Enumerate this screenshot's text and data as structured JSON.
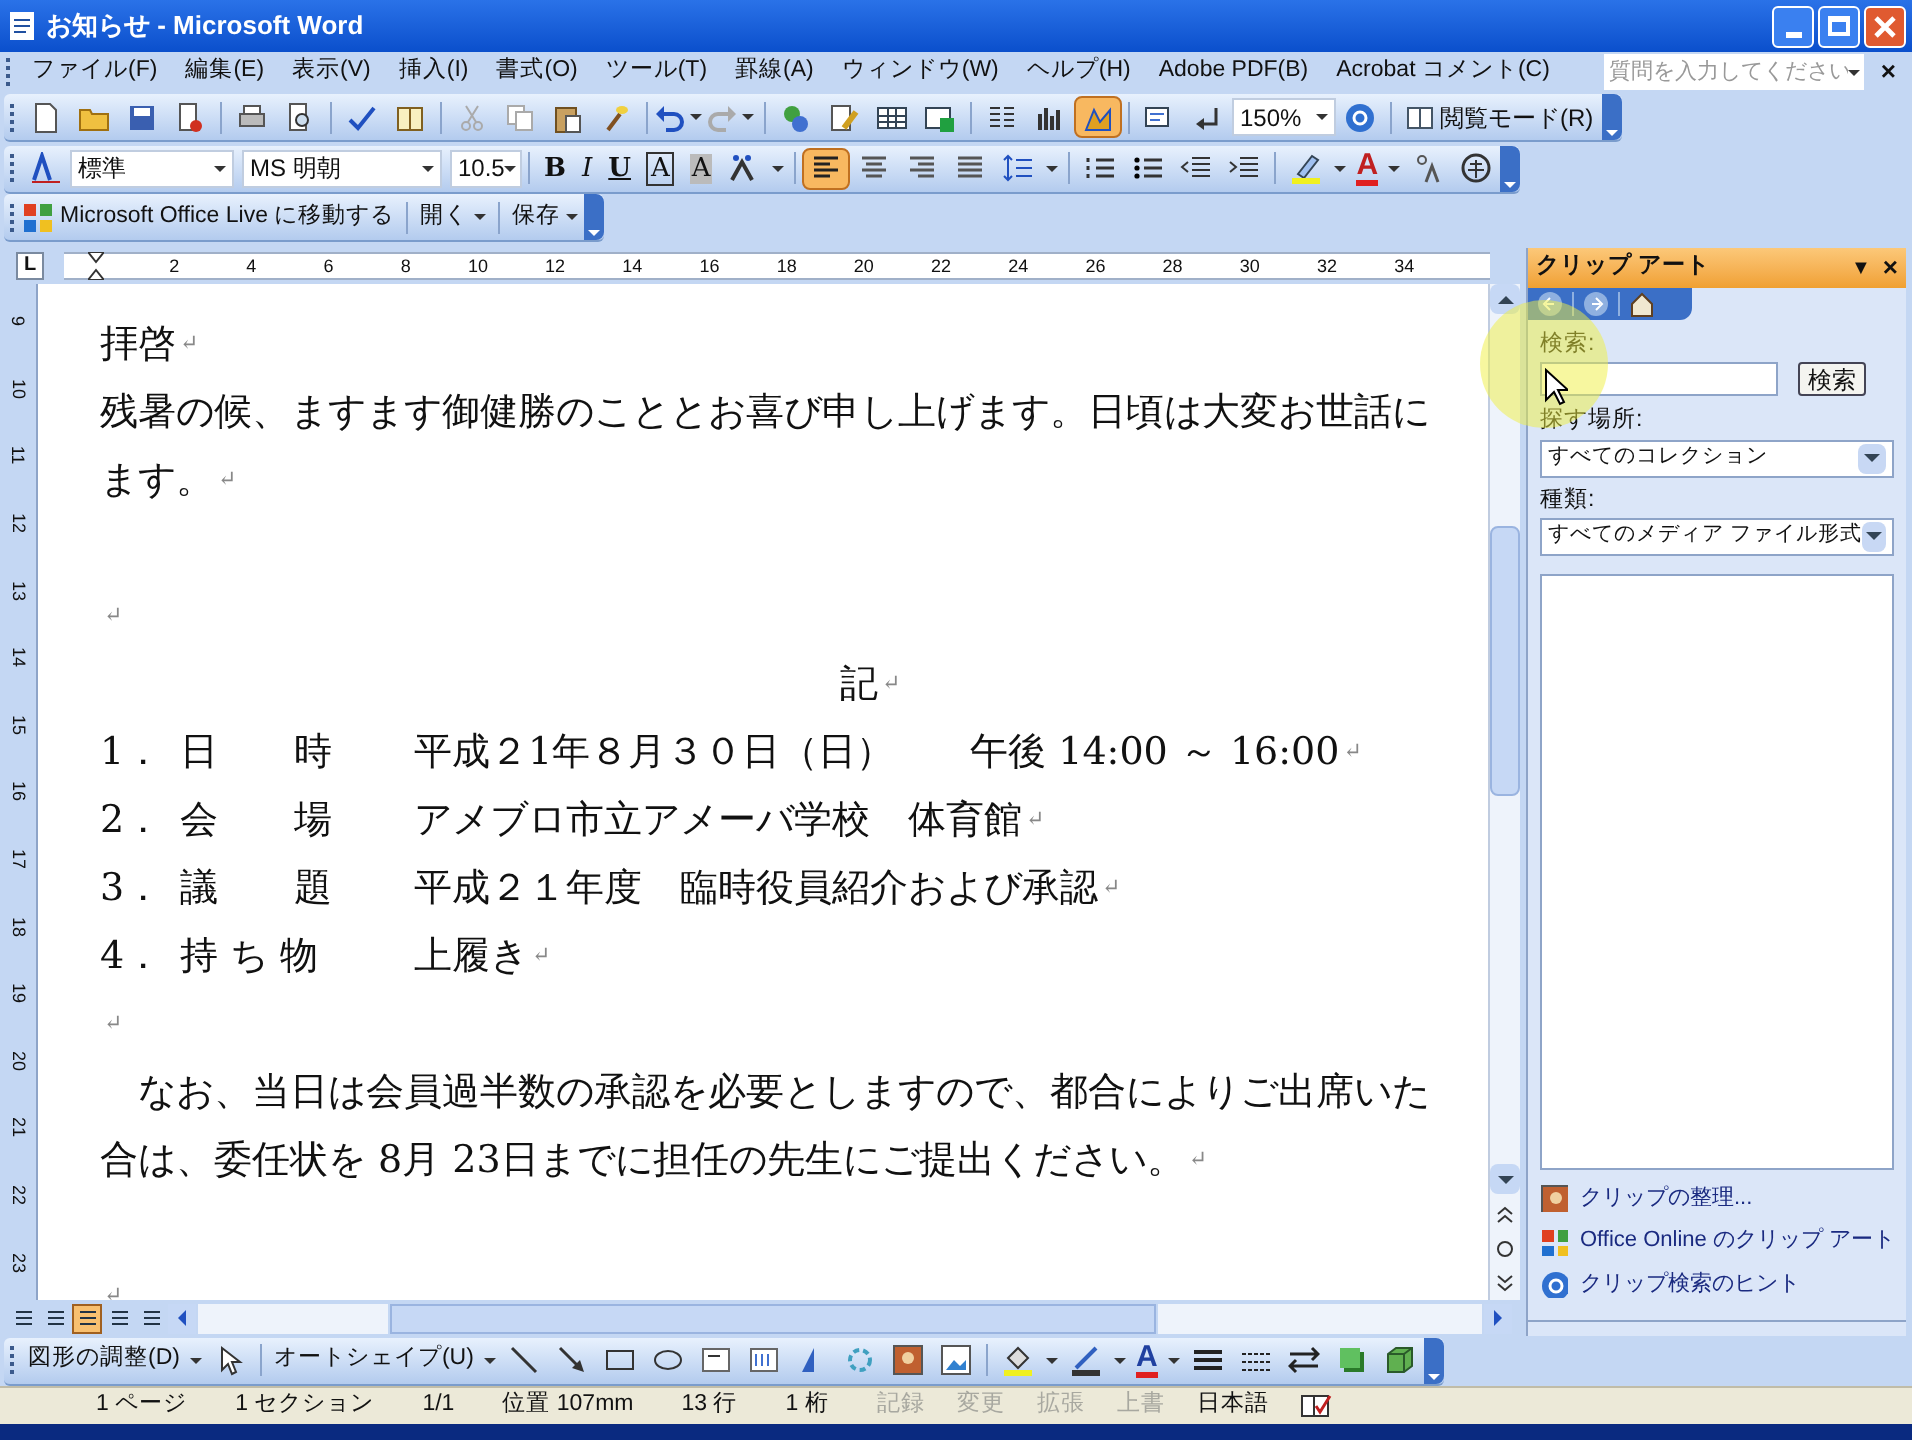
{
  "window": {
    "title": "お知らせ - Microsoft Word"
  },
  "menu": [
    "ファイル(F)",
    "編集(E)",
    "表示(V)",
    "挿入(I)",
    "書式(O)",
    "ツール(T)",
    "罫線(A)",
    "ウィンドウ(W)",
    "ヘルプ(H)",
    "Adobe PDF(B)",
    "Acrobat コメント(C)"
  ],
  "help_box": {
    "placeholder": "質問を入力してください",
    "close": "×"
  },
  "standard_toolbar": {
    "drawing": {
      "selected": true
    },
    "zoom": "150%",
    "reading_mode": "閲覧モード(R)"
  },
  "formatting_toolbar": {
    "style": "標準",
    "font": "MS 明朝",
    "size": "10.5",
    "format_buttons": [
      "B",
      "I",
      "U",
      "A",
      "A"
    ],
    "alignment": [
      {
        "selected": true
      },
      {
        "selected": false
      },
      {
        "selected": false
      },
      {
        "selected": false
      }
    ],
    "font_color": "A"
  },
  "web_toolbar": {
    "items": [
      "Microsoft Office Live に移動する",
      "開く",
      "保存"
    ]
  },
  "ruler": {
    "tab": "L",
    "labels": [
      "2",
      "4",
      "6",
      "8",
      "10",
      "12",
      "14",
      "16",
      "18",
      "20",
      "22",
      "24",
      "26",
      "28",
      "30",
      "32",
      "34"
    ]
  },
  "vertical_ruler": [
    "9",
    "10",
    "11",
    "12",
    "13",
    "14",
    "15",
    "16",
    "17",
    "18",
    "19",
    "20",
    "21",
    "22",
    "23"
  ],
  "document": {
    "lines": [
      {
        "kind": "text",
        "text": "拝啓",
        "mark": "↵"
      },
      {
        "kind": "text",
        "text": "残暑の候、ますます御健勝のこととお喜び申し上げます。日頃は大変お世話に"
      },
      {
        "kind": "text",
        "text": "ます。",
        "mark": "↵"
      },
      {
        "kind": "gap"
      },
      {
        "kind": "text",
        "mark": "↵"
      },
      {
        "kind": "center",
        "text": "記",
        "mark": "↵"
      },
      {
        "kind": "item",
        "number": "1．",
        "label": "日　　時",
        "value": "平成２1年８月３０日（日）　　午後 14:00 ～ 16:00",
        "mark": "↵"
      },
      {
        "kind": "item",
        "number": "2．",
        "label": "会　　場",
        "value": "アメブロ市立アメーバ学校　体育館",
        "mark": "↵"
      },
      {
        "kind": "item",
        "number": "3．",
        "label": "議　　題",
        "value": "平成２１年度　臨時役員紹介および承認",
        "mark": "↵"
      },
      {
        "kind": "item",
        "number": "4．",
        "label": "持 ち 物",
        "value": "上履き",
        "mark": "↵"
      },
      {
        "kind": "text",
        "mark": "↵"
      },
      {
        "kind": "text",
        "text": "　なお、当日は会員過半数の承認を必要としますので、都合によりご出席いた"
      },
      {
        "kind": "text",
        "text": "合は、委任状を 8月 23日までに担任の先生にご提出ください。",
        "mark": "↵"
      },
      {
        "kind": "gap"
      },
      {
        "kind": "text",
        "mark": "↵"
      }
    ]
  },
  "task_pane": {
    "title": "クリップ アート",
    "menu": "▼",
    "close": "×",
    "search_label": "検索:",
    "search_button": "検索",
    "location_label": "探す場所:",
    "location": "すべてのコレクション",
    "type_label": "種類:",
    "type": "すべてのメディア ファイル形式",
    "links": [
      "クリップの整理...",
      "Office Online のクリップ アート",
      "クリップ検索のヒント"
    ]
  },
  "drawing_toolbar": {
    "arrange": "図形の調整(D)",
    "autoshapes": "オートシェイプ(U)",
    "font_color": "A"
  },
  "status_bar": [
    {
      "text": "1 ページ",
      "disabled": false
    },
    {
      "text": "1 セクション",
      "disabled": false
    },
    {
      "text": "1/1",
      "disabled": false
    },
    {
      "text": "位置 107mm",
      "disabled": false
    },
    {
      "text": "13 行",
      "disabled": false
    },
    {
      "text": "1 桁",
      "disabled": false
    },
    {
      "text": "記録",
      "disabled": true
    },
    {
      "text": "変更",
      "disabled": true
    },
    {
      "text": "拡張",
      "disabled": true
    },
    {
      "text": "上書",
      "disabled": true
    },
    {
      "text": "日本語",
      "disabled": false
    }
  ]
}
